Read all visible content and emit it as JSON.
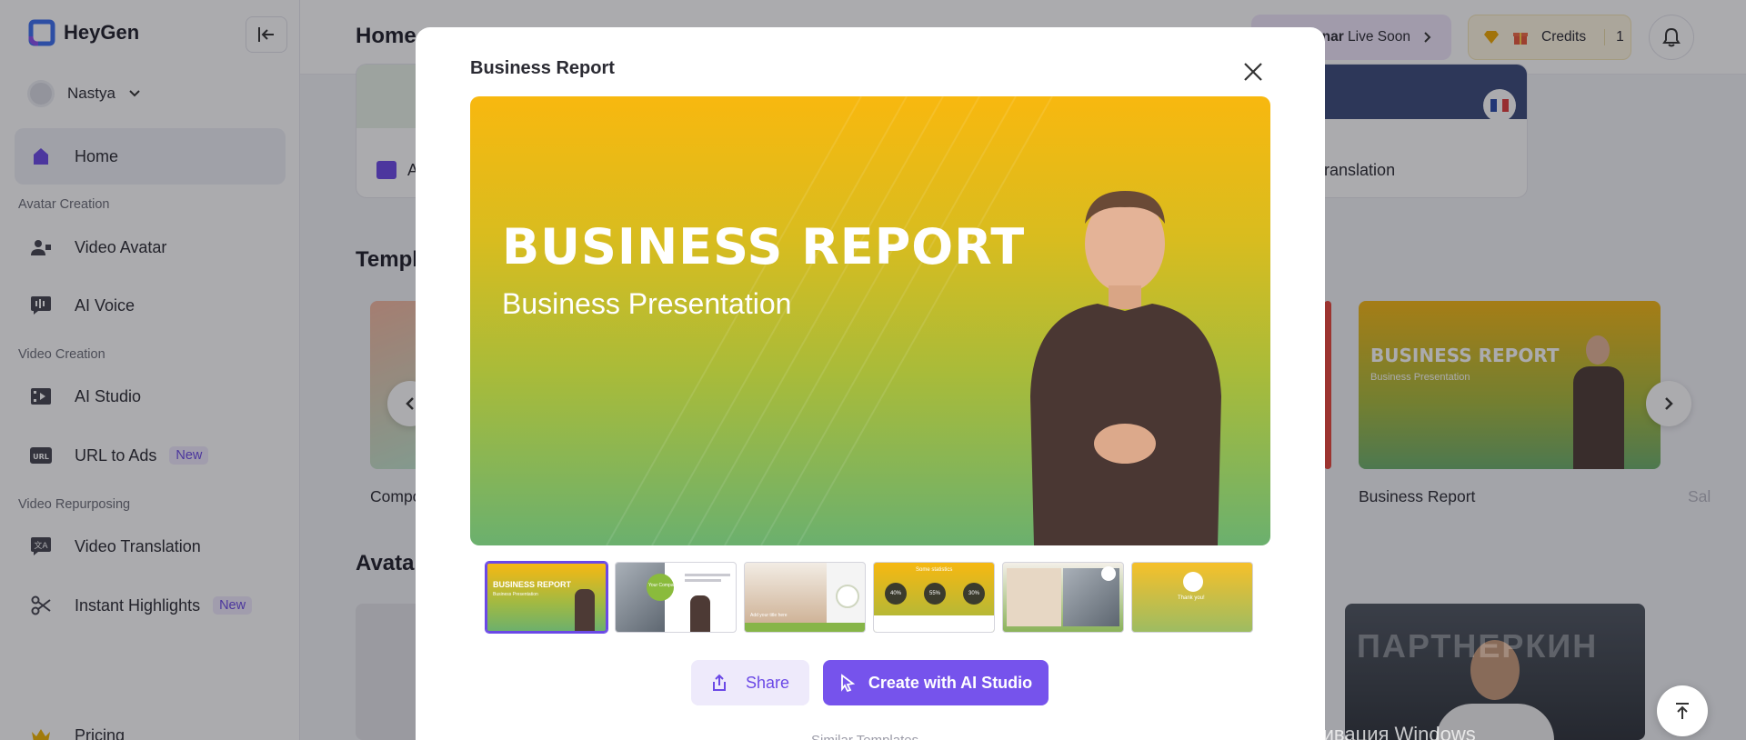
{
  "app": {
    "name": "HeyGen",
    "page_title": "Home"
  },
  "sidebar": {
    "user": "Nastya",
    "items": {
      "home": "Home",
      "video_avatar": "Video Avatar",
      "ai_voice": "AI Voice",
      "ai_studio": "AI Studio",
      "url_to_ads": "URL to Ads",
      "video_translation": "Video Translation",
      "instant_highlights": "Instant Highlights",
      "pricing": "Pricing"
    },
    "sections": {
      "avatar_creation": "Avatar Creation",
      "video_creation": "Video Creation",
      "video_repurposing": "Video Repurposing"
    },
    "new_badge": "New"
  },
  "header": {
    "webinar_bold": "nar",
    "webinar_text": "Live Soon",
    "credits_label": "Credits",
    "credits_count": "1"
  },
  "background": {
    "card_left_text": "A",
    "card_right_text": "deo Translation",
    "templates_title": "Templ",
    "avatars_title": "Avata",
    "tpl_left_caption": "Compo",
    "tpl_right_caption": "Business Report",
    "tpl_far_caption": "Sal",
    "tpl_right_thumb_title": "BUSINESS REPORT",
    "tpl_right_thumb_sub": "Business Presentation"
  },
  "modal": {
    "title": "Business Report",
    "preview_title": "BUSINESS REPORT",
    "preview_subtitle": "Business Presentation",
    "thumb_labels": [
      "BUSINESS REPORT",
      "Business Presentation",
      "Your Company",
      "Add your title here",
      "Some statistics",
      "40%",
      "55%",
      "30%",
      "Thank you!"
    ],
    "share_label": "Share",
    "create_label": "Create with AI Studio",
    "similar_label": "Similar Templates"
  },
  "watermarks": {
    "windows": "Активация Windows",
    "brand": "ПАРТНЕРКИН"
  },
  "colors": {
    "accent": "#7653ec",
    "accent_soft": "#eeeafb"
  }
}
